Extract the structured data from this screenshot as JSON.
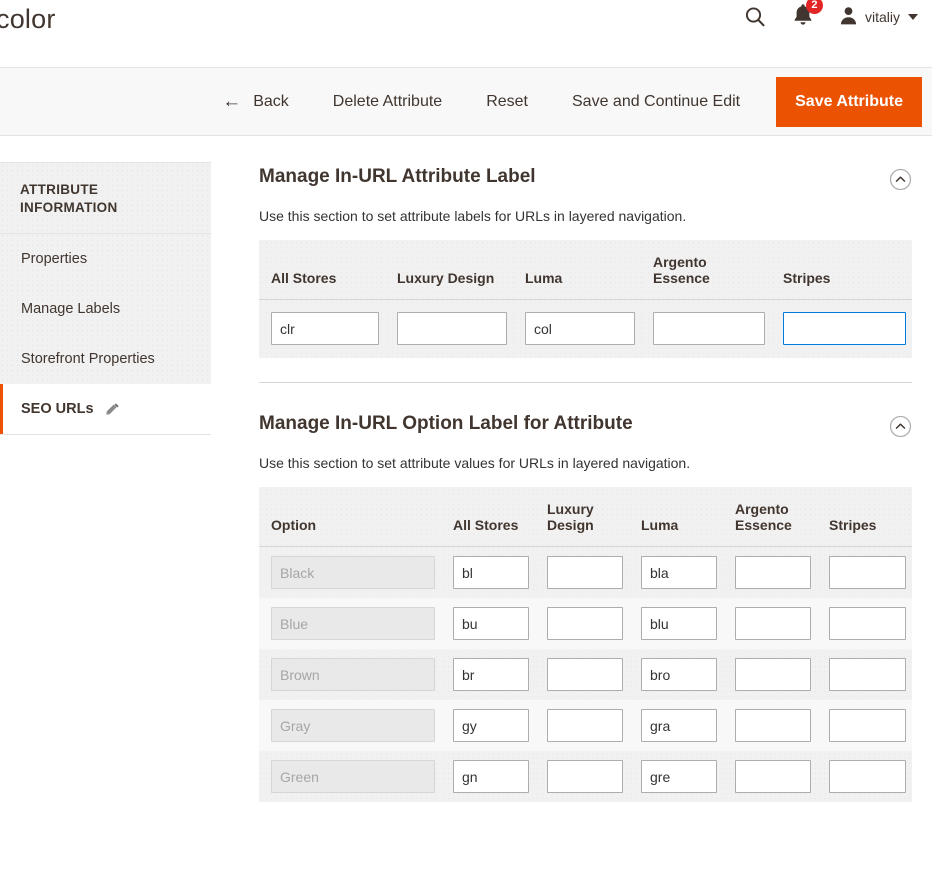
{
  "header": {
    "title": "color",
    "search_icon": "search-icon",
    "notifications_icon": "bell-icon",
    "notifications_count": "2",
    "user_name": "vitaliy",
    "user_icon": "user-avatar-icon",
    "caret_icon": "chevron-down-icon"
  },
  "toolbar": {
    "back_label": "Back",
    "back_icon": "arrow-left-icon",
    "delete_label": "Delete Attribute",
    "reset_label": "Reset",
    "save_continue_label": "Save and Continue Edit",
    "save_label": "Save Attribute",
    "primary_color": "#eb5202"
  },
  "sidebar": {
    "title": "ATTRIBUTE INFORMATION",
    "items": [
      {
        "label": "Properties",
        "active": false
      },
      {
        "label": "Manage Labels",
        "active": false
      },
      {
        "label": "Storefront Properties",
        "active": false
      },
      {
        "label": "SEO URLs",
        "active": true,
        "icon": "pencil-icon"
      }
    ],
    "active_marker_color": "#eb5202"
  },
  "sections": [
    {
      "title": "Manage In-URL Attribute Label",
      "note": "Use this section to set attribute labels for URLs in layered navigation.",
      "collapse_icon": "chevron-up-circle-icon",
      "columns": [
        "All Stores",
        "Luxury Design",
        "Luma",
        "Argento Essence",
        "Stripes"
      ],
      "values": [
        "clr",
        "",
        "col",
        "",
        ""
      ],
      "focused_index": 4
    },
    {
      "title": "Manage In-URL Option Label for Attribute",
      "note": "Use this section to set attribute values for URLs in layered navigation.",
      "collapse_icon": "chevron-up-circle-icon",
      "columns": [
        "Option",
        "All Stores",
        "Luxury Design",
        "Luma",
        "Argento Essence",
        "Stripes"
      ],
      "rows": [
        {
          "option": "Black",
          "values": [
            "bl",
            "",
            "bla",
            "",
            ""
          ]
        },
        {
          "option": "Blue",
          "values": [
            "bu",
            "",
            "blu",
            "",
            ""
          ]
        },
        {
          "option": "Brown",
          "values": [
            "br",
            "",
            "bro",
            "",
            ""
          ]
        },
        {
          "option": "Gray",
          "values": [
            "gy",
            "",
            "gra",
            "",
            ""
          ]
        },
        {
          "option": "Green",
          "values": [
            "gn",
            "",
            "gre",
            "",
            ""
          ]
        }
      ]
    }
  ]
}
